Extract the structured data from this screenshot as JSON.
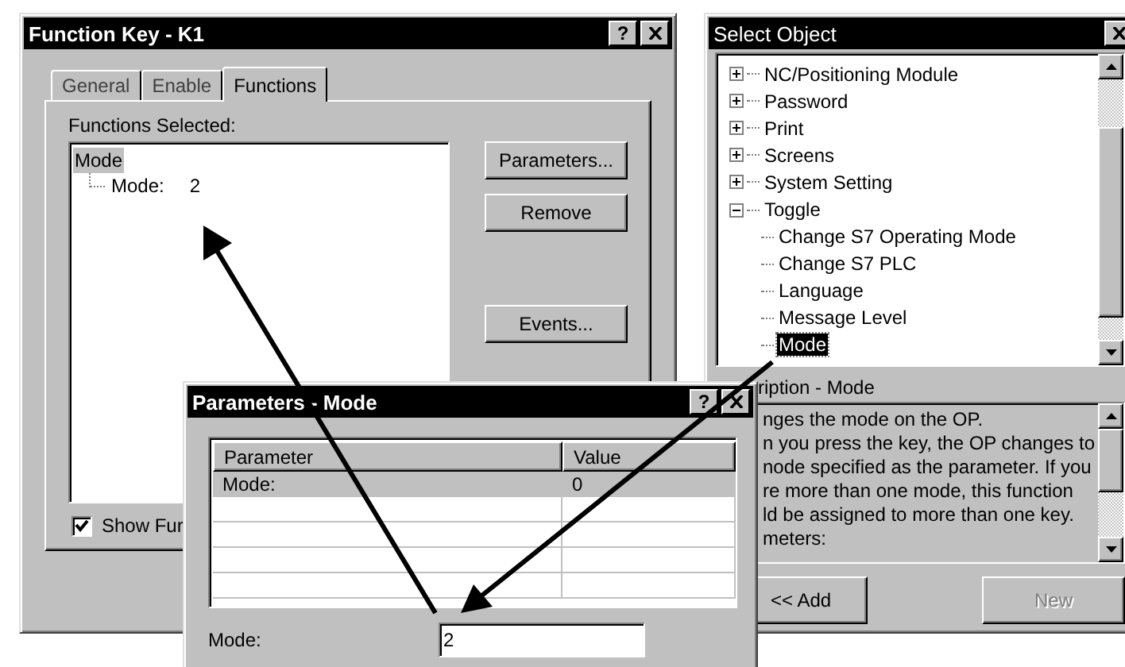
{
  "function_key_window": {
    "title": "Function Key - K1",
    "help": "?",
    "tabs": [
      {
        "label": "General",
        "selected": false
      },
      {
        "label": "Enable",
        "selected": false
      },
      {
        "label": "Functions",
        "selected": true
      }
    ],
    "functions_label": "Functions Selected:",
    "functions_tree": [
      {
        "label": "Mode",
        "selected": true,
        "children": [
          {
            "label": "Mode:",
            "value": "2",
            "selected": false
          }
        ]
      }
    ],
    "buttons": [
      {
        "label": "Parameters...",
        "kind": "top"
      },
      {
        "label": "Remove",
        "kind": "top"
      },
      {
        "label": "Events...",
        "kind": "lower"
      }
    ],
    "show_checkbox": {
      "label": "Show Fur",
      "checked": true
    }
  },
  "select_object_window": {
    "title": "Select Object",
    "tree": [
      {
        "label": "NC/Positioning Module",
        "expanded": false,
        "selected": false
      },
      {
        "label": "Password",
        "expanded": false,
        "selected": false
      },
      {
        "label": "Print",
        "expanded": false,
        "selected": false
      },
      {
        "label": "Screens",
        "expanded": false,
        "selected": false
      },
      {
        "label": "System Setting",
        "expanded": false,
        "selected": false
      },
      {
        "label": "Toggle",
        "expanded": true,
        "selected": false,
        "children": [
          {
            "label": "Change S7 Operating Mode",
            "selected": false
          },
          {
            "label": "Change S7 PLC",
            "selected": false
          },
          {
            "label": "Language",
            "selected": false
          },
          {
            "label": "Message Level",
            "selected": false
          },
          {
            "label": "Mode",
            "selected": true
          }
        ]
      }
    ],
    "description_label": "ription - Mode",
    "description_lines": [
      "nges the mode on the OP.",
      "n you press the key, the OP changes to",
      "node specified as the parameter. If you",
      "re more than one mode, this function",
      "ld be assigned to more than one key.",
      "meters:"
    ],
    "buttons": [
      {
        "label": "<< Add",
        "disabled": false
      },
      {
        "label": "New",
        "disabled": true
      }
    ]
  },
  "parameters_window": {
    "title": "Parameters - Mode",
    "help": "?",
    "columns": [
      "Parameter",
      "Value"
    ],
    "rows": [
      {
        "cells": [
          "Mode:",
          "0"
        ],
        "selected": true
      }
    ],
    "field": {
      "label": "Mode:",
      "value": "2"
    }
  }
}
